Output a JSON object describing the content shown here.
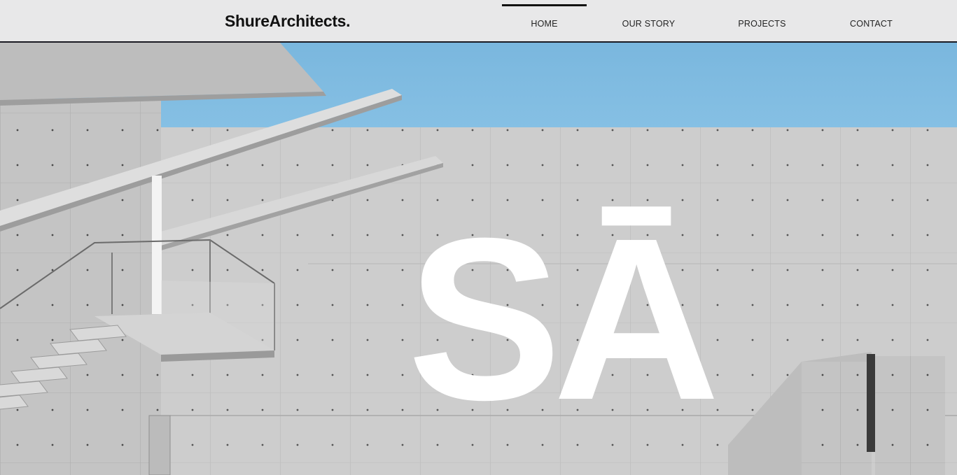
{
  "header": {
    "logo": "ShureArchitects."
  },
  "nav": {
    "items": [
      {
        "label": "HOME",
        "active": true
      },
      {
        "label": "OUR STORY",
        "active": false
      },
      {
        "label": "PROJECTS",
        "active": false
      },
      {
        "label": "CONTACT",
        "active": false
      }
    ]
  },
  "hero": {
    "monogram": "SĀ",
    "image_subject": "concrete-building-with-stairs"
  },
  "colors": {
    "header_bg": "#e8e8e9",
    "header_border": "#1a1a22",
    "sky": "#7fbbe0",
    "concrete": "#cfcfcf",
    "monogram": "#ffffff"
  }
}
